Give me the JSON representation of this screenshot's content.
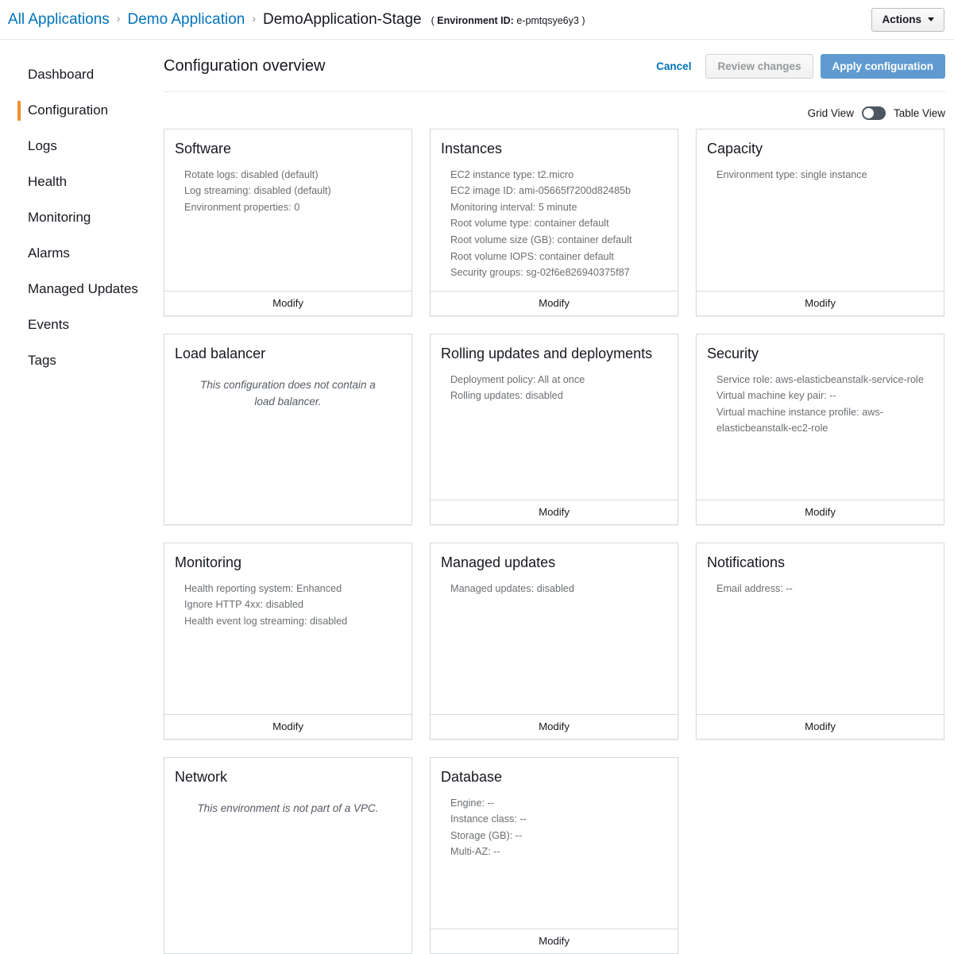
{
  "topbar": {
    "breadcrumb": [
      {
        "label": "All Applications",
        "type": "link"
      },
      {
        "label": "Demo Application",
        "type": "link"
      },
      {
        "label": "DemoApplication-Stage",
        "type": "current"
      }
    ],
    "separator": "›",
    "env_paren_open": "(",
    "env_id_label": "Environment ID:",
    "env_id_value": "e-pmtqsye6y3",
    "env_paren_close": ")",
    "actions_label": "Actions"
  },
  "sidebar": {
    "items": [
      {
        "label": "Dashboard",
        "active": false
      },
      {
        "label": "Configuration",
        "active": true
      },
      {
        "label": "Logs",
        "active": false
      },
      {
        "label": "Health",
        "active": false
      },
      {
        "label": "Monitoring",
        "active": false
      },
      {
        "label": "Alarms",
        "active": false
      },
      {
        "label": "Managed Updates",
        "active": false
      },
      {
        "label": "Events",
        "active": false
      },
      {
        "label": "Tags",
        "active": false
      }
    ]
  },
  "page": {
    "title": "Configuration overview",
    "cancel_label": "Cancel",
    "review_changes_label": "Review changes",
    "apply_label": "Apply configuration",
    "grid_view_label": "Grid View",
    "table_view_label": "Table View",
    "toggle_state": "grid",
    "modify_label": "Modify"
  },
  "colors": {
    "link": "#0073bb",
    "primary_button": "#5f9bd0",
    "active_indicator": "#ec912d",
    "toggle_track": "#4d5761",
    "card_border": "#d5dbdb",
    "body_text": "#6b6f73"
  },
  "cards": [
    {
      "title": "Software",
      "lines": [
        "Rotate logs: disabled (default)",
        "Log streaming: disabled (default)",
        "Environment properties: 0"
      ],
      "empty_message": null,
      "has_modify": true
    },
    {
      "title": "Instances",
      "lines": [
        "EC2 instance type: t2.micro",
        "EC2 image ID: ami-05665f7200d82485b",
        "Monitoring interval: 5 minute",
        "Root volume type: container default",
        "Root volume size (GB): container default",
        "Root volume IOPS: container default",
        "Security groups: sg-02f6e826940375f87"
      ],
      "empty_message": null,
      "has_modify": true
    },
    {
      "title": "Capacity",
      "lines": [
        "Environment type: single instance"
      ],
      "empty_message": null,
      "has_modify": true
    },
    {
      "title": "Load balancer",
      "lines": [],
      "empty_message": "This configuration does not contain a load balancer.",
      "has_modify": false
    },
    {
      "title": "Rolling updates and deployments",
      "lines": [
        "Deployment policy: All at once",
        "Rolling updates: disabled"
      ],
      "empty_message": null,
      "has_modify": true
    },
    {
      "title": "Security",
      "lines": [
        "Service role: aws-elasticbeanstalk-service-role",
        "Virtual machine key pair: --",
        "Virtual machine instance profile: aws-elasticbeanstalk-ec2-role"
      ],
      "empty_message": null,
      "has_modify": true
    },
    {
      "title": "Monitoring",
      "lines": [
        "Health reporting system: Enhanced",
        "Ignore HTTP 4xx: disabled",
        "Health event log streaming: disabled"
      ],
      "empty_message": null,
      "has_modify": true
    },
    {
      "title": "Managed updates",
      "lines": [
        "Managed updates: disabled"
      ],
      "empty_message": null,
      "has_modify": true
    },
    {
      "title": "Notifications",
      "lines": [
        "Email address: --"
      ],
      "empty_message": null,
      "has_modify": true
    },
    {
      "title": "Network",
      "lines": [],
      "empty_message": "This environment is not part of a VPC.",
      "has_modify": false
    },
    {
      "title": "Database",
      "lines": [
        "Engine: --",
        "Instance class: --",
        "Storage (GB): --",
        "Multi-AZ: --"
      ],
      "empty_message": null,
      "has_modify": true
    }
  ]
}
